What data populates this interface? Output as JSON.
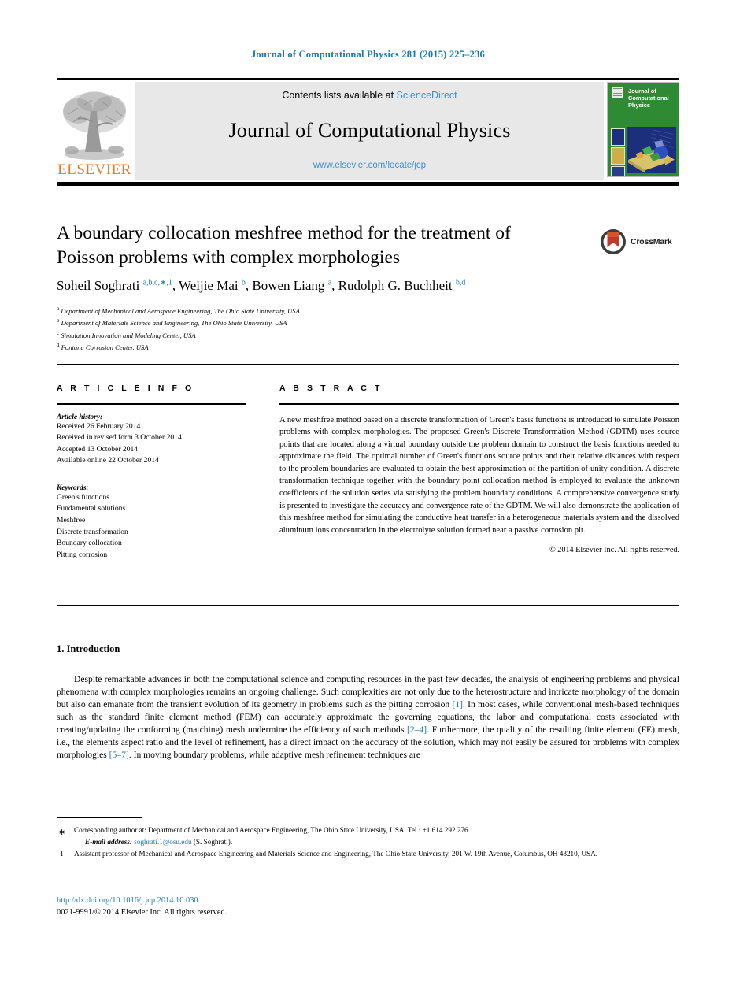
{
  "running_head": "Journal of Computational Physics 281 (2015) 225–236",
  "masthead": {
    "elsevier_wordmark": "ELSEVIER",
    "contents_prefix": "Contents lists available at",
    "sciencedirect": "ScienceDirect",
    "journal_name": "Journal of Computational Physics",
    "journal_url": "www.elsevier.com/locate/jcp",
    "cover_title": "Journal of Computational Physics",
    "accent_blue": "#3a8fd0",
    "elsevier_orange": "#E87722",
    "cover_green": "#2e8b34"
  },
  "article": {
    "title": "A boundary collocation meshfree method for the treatment of Poisson problems with complex morphologies",
    "crossmark_label": "CrossMark",
    "authors_html": "Soheil Soghrati <sup>a,b,c,∗,1</sup>, Weijie Mai <sup>b</sup>, Bowen Liang <sup>a</sup>, Rudolph G. Buchheit <sup>b,d</sup>",
    "affiliations": [
      {
        "mark": "a",
        "text": "Department of Mechanical and Aerospace Engineering, The Ohio State University, USA"
      },
      {
        "mark": "b",
        "text": "Department of Materials Science and Engineering, The Ohio State University, USA"
      },
      {
        "mark": "c",
        "text": "Simulation Innovation and Modeling Center, USA"
      },
      {
        "mark": "d",
        "text": "Fontana Corrosion Center, USA"
      }
    ]
  },
  "article_info": {
    "heading": "A R T I C L E   I N F O",
    "history_label": "Article history:",
    "history": [
      "Received 26 February 2014",
      "Received in revised form 3 October 2014",
      "Accepted 13 October 2014",
      "Available online 22 October 2014"
    ],
    "keywords_label": "Keywords:",
    "keywords": [
      "Green's functions",
      "Fundamental solutions",
      "Meshfree",
      "Discrete transformation",
      "Boundary collocation",
      "Pitting corrosion"
    ]
  },
  "abstract": {
    "heading": "A B S T R A C T",
    "text": "A new meshfree method based on a discrete transformation of Green's basis functions is introduced to simulate Poisson problems with complex morphologies. The proposed Green's Discrete Transformation Method (GDTM) uses source points that are located along a virtual boundary outside the problem domain to construct the basis functions needed to approximate the field. The optimal number of Green's functions source points and their relative distances with respect to the problem boundaries are evaluated to obtain the best approximation of the partition of unity condition. A discrete transformation technique together with the boundary point collocation method is employed to evaluate the unknown coefficients of the solution series via satisfying the problem boundary conditions. A comprehensive convergence study is presented to investigate the accuracy and convergence rate of the GDTM. We will also demonstrate the application of this meshfree method for simulating the conductive heat transfer in a heterogeneous materials system and the dissolved aluminum ions concentration in the electrolyte solution formed near a passive corrosion pit.",
    "copyright": "© 2014 Elsevier Inc. All rights reserved."
  },
  "introduction": {
    "heading": "1. Introduction",
    "paragraph_parts": {
      "p1": "Despite remarkable advances in both the computational science and computing resources in the past few decades, the analysis of engineering problems and physical phenomena with complex morphologies remains an ongoing challenge. Such complexities are not only due to the heterostructure and intricate morphology of the domain but also can emanate from the transient evolution of its geometry in problems such as the pitting corrosion ",
      "cite1": "[1]",
      "p2": ". In most cases, while conventional mesh-based techniques such as the standard finite element method (FEM) can accurately approximate the governing equations, the labor and computational costs associated with creating/updating the conforming (matching) mesh undermine the efficiency of such methods ",
      "cite2": "[2–4]",
      "p3": ". Furthermore, the quality of the resulting finite element (FE) mesh, i.e., the elements aspect ratio and the level of refinement, has a direct impact on the accuracy of the solution, which may not easily be assured for problems with complex morphologies ",
      "cite3": "[5–7]",
      "p4": ". In moving boundary problems, while adaptive mesh refinement techniques are"
    }
  },
  "footnotes": {
    "corresponding": {
      "mark": "∗",
      "text": "Corresponding author at: Department of Mechanical and Aerospace Engineering, The Ohio State University, USA. Tel.: +1 614 292 276."
    },
    "email": {
      "label": "E-mail address:",
      "address": "soghrati.1@osu.edu",
      "suffix": "(S. Soghrati)."
    },
    "note1": {
      "mark": "1",
      "text": "Assistant professor of Mechanical and Aerospace Engineering and Materials Science and Engineering, The Ohio State University, 201 W. 19th Avenue, Columbus, OH 43210, USA."
    }
  },
  "footer": {
    "doi": "http://dx.doi.org/10.1016/j.jcp.2014.10.030",
    "issn_line": "0021-9991/© 2014 Elsevier Inc. All rights reserved."
  }
}
